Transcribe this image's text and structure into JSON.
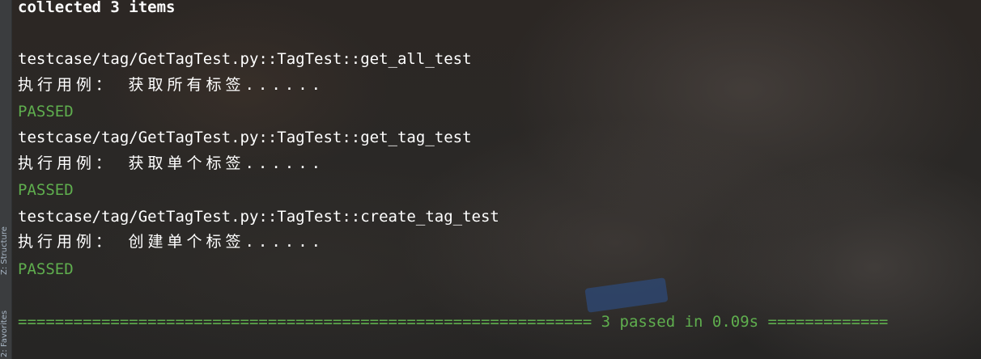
{
  "sidebar": {
    "tabs": [
      {
        "label": "Z: Structure"
      },
      {
        "label": "2: Favorites"
      }
    ]
  },
  "console": {
    "header": "collected 3 items",
    "tests": [
      {
        "id": "testcase/tag/GetTagTest.py::TagTest::get_all_test",
        "message": "执行用例： 获取所有标签......",
        "result": "PASSED"
      },
      {
        "id": "testcase/tag/GetTagTest.py::TagTest::get_tag_test",
        "message": "执行用例： 获取单个标签......",
        "result": "PASSED"
      },
      {
        "id": "testcase/tag/GetTagTest.py::TagTest::create_tag_test",
        "message": "执行用例： 创建单个标签......",
        "result": "PASSED"
      }
    ],
    "summary": "============================================================== 3 passed in 0.09s ============="
  },
  "colors": {
    "pass_green": "#5fae4e",
    "text": "#ffffff"
  }
}
